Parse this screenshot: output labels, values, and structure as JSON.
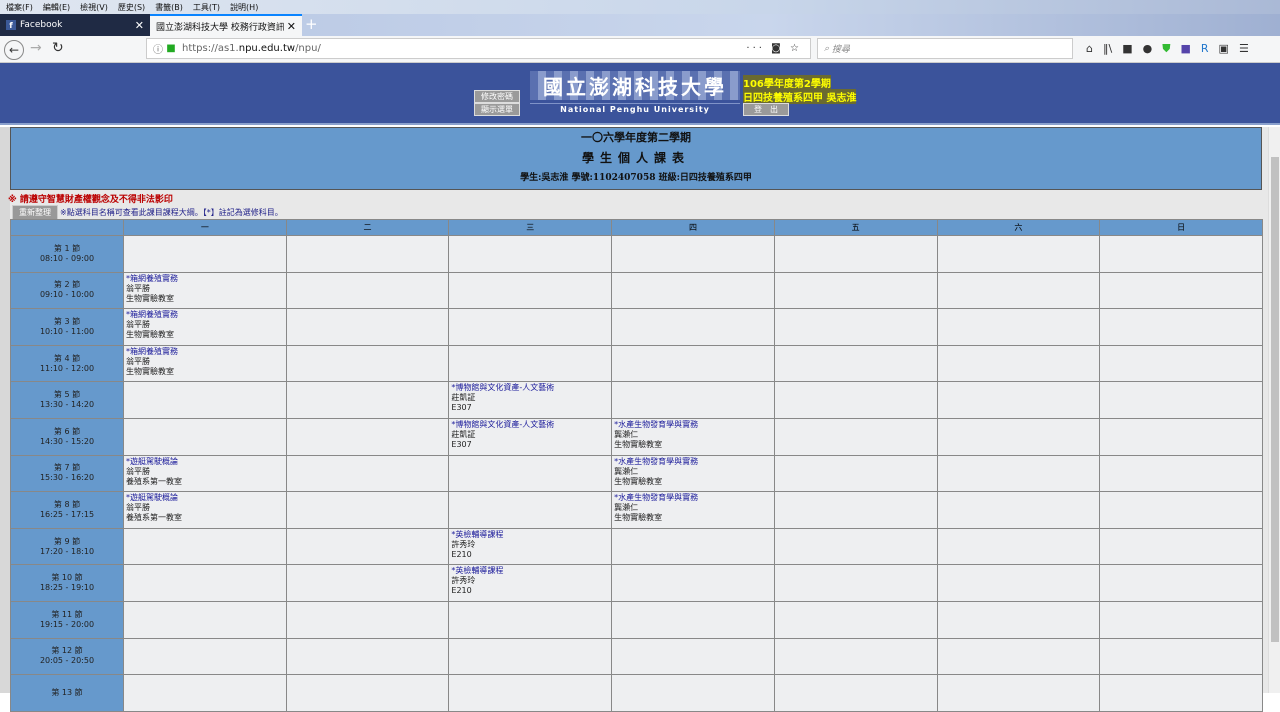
{
  "browser": {
    "menu": [
      "檔案(F)",
      "編輯(E)",
      "檢視(V)",
      "歷史(S)",
      "書籤(B)",
      "工具(T)",
      "說明(H)"
    ],
    "tabs": [
      {
        "label": "Facebook"
      },
      {
        "label": "國立澎湖科技大學 校務行政資訊系"
      }
    ],
    "url_prefix": "https://as1.",
    "url_host": "npu.edu.tw",
    "url_path": "/npu/",
    "search_placeholder": "搜尋"
  },
  "banner": {
    "change_password": "修改密碼",
    "show_menu": "顯示選單",
    "school_cn": "國立澎湖科技大學",
    "school_en": "National Penghu University",
    "term": "106學年度第2學期",
    "class_name": "日四技養殖系四甲 吳志淮",
    "logout": "登　出"
  },
  "page": {
    "title1": "一〇六學年度第二學期",
    "title2": "學生個人課表",
    "student_info": "學生:吳志淮 學號:1102407058 班級:日四技養殖系四甲",
    "notice": "※ 請遵守智慧財產權觀念及不得非法影印",
    "reload": "重新整理",
    "hint": "※點選科目名稱可查看此課目課程大綱。【*】註記為選修科目。"
  },
  "schedule": {
    "days": [
      "",
      "一",
      "二",
      "三",
      "四",
      "五",
      "六",
      "日"
    ],
    "rows": [
      {
        "period": "第 1 節",
        "time": "08:10 - 09:00",
        "cells": [
          null,
          null,
          null,
          null,
          null,
          null,
          null
        ]
      },
      {
        "period": "第 2 節",
        "time": "09:10 - 10:00",
        "cells": [
          {
            "name": "*箱網養殖實務",
            "teacher": "翁平勝",
            "room": "生物實驗教室"
          },
          null,
          null,
          null,
          null,
          null,
          null
        ]
      },
      {
        "period": "第 3 節",
        "time": "10:10 - 11:00",
        "cells": [
          {
            "name": "*箱網養殖實務",
            "teacher": "翁平勝",
            "room": "生物實驗教室"
          },
          null,
          null,
          null,
          null,
          null,
          null
        ]
      },
      {
        "period": "第 4 節",
        "time": "11:10 - 12:00",
        "cells": [
          {
            "name": "*箱網養殖實務",
            "teacher": "翁平勝",
            "room": "生物實驗教室"
          },
          null,
          null,
          null,
          null,
          null,
          null
        ]
      },
      {
        "period": "第 5 節",
        "time": "13:30 - 14:20",
        "cells": [
          null,
          null,
          {
            "name": "*博物館與文化資產-人文藝術",
            "teacher": "莊凱証",
            "room": "E307"
          },
          null,
          null,
          null,
          null
        ]
      },
      {
        "period": "第 6 節",
        "time": "14:30 - 15:20",
        "cells": [
          null,
          null,
          {
            "name": "*博物館與文化資產-人文藝術",
            "teacher": "莊凱証",
            "room": "E307"
          },
          {
            "name": "*水產生物發育學與實務",
            "teacher": "龔瀨仁",
            "room": "生物實驗教室"
          },
          null,
          null,
          null
        ]
      },
      {
        "period": "第 7 節",
        "time": "15:30 - 16:20",
        "cells": [
          {
            "name": "*遊艇駕駛概論",
            "teacher": "翁平勝",
            "room": "養殖系第一教室"
          },
          null,
          null,
          {
            "name": "*水產生物發育學與實務",
            "teacher": "龔瀨仁",
            "room": "生物實驗教室"
          },
          null,
          null,
          null
        ]
      },
      {
        "period": "第 8 節",
        "time": "16:25 - 17:15",
        "cells": [
          {
            "name": "*遊艇駕駛概論",
            "teacher": "翁平勝",
            "room": "養殖系第一教室"
          },
          null,
          null,
          {
            "name": "*水產生物發育學與實務",
            "teacher": "龔瀨仁",
            "room": "生物實驗教室"
          },
          null,
          null,
          null
        ]
      },
      {
        "period": "第 9 節",
        "time": "17:20 - 18:10",
        "cells": [
          null,
          null,
          {
            "name": "*英檢輔導課程",
            "teacher": "許秀玲",
            "room": "E210"
          },
          null,
          null,
          null,
          null
        ]
      },
      {
        "period": "第 10 節",
        "time": "18:25 - 19:10",
        "cells": [
          null,
          null,
          {
            "name": "*英檢輔導課程",
            "teacher": "許秀玲",
            "room": "E210"
          },
          null,
          null,
          null,
          null
        ]
      },
      {
        "period": "第 11 節",
        "time": "19:15 - 20:00",
        "cells": [
          null,
          null,
          null,
          null,
          null,
          null,
          null
        ]
      },
      {
        "period": "第 12 節",
        "time": "20:05 - 20:50",
        "cells": [
          null,
          null,
          null,
          null,
          null,
          null,
          null
        ]
      },
      {
        "period": "第 13 節",
        "time": "",
        "cells": [
          null,
          null,
          null,
          null,
          null,
          null,
          null
        ]
      }
    ]
  }
}
